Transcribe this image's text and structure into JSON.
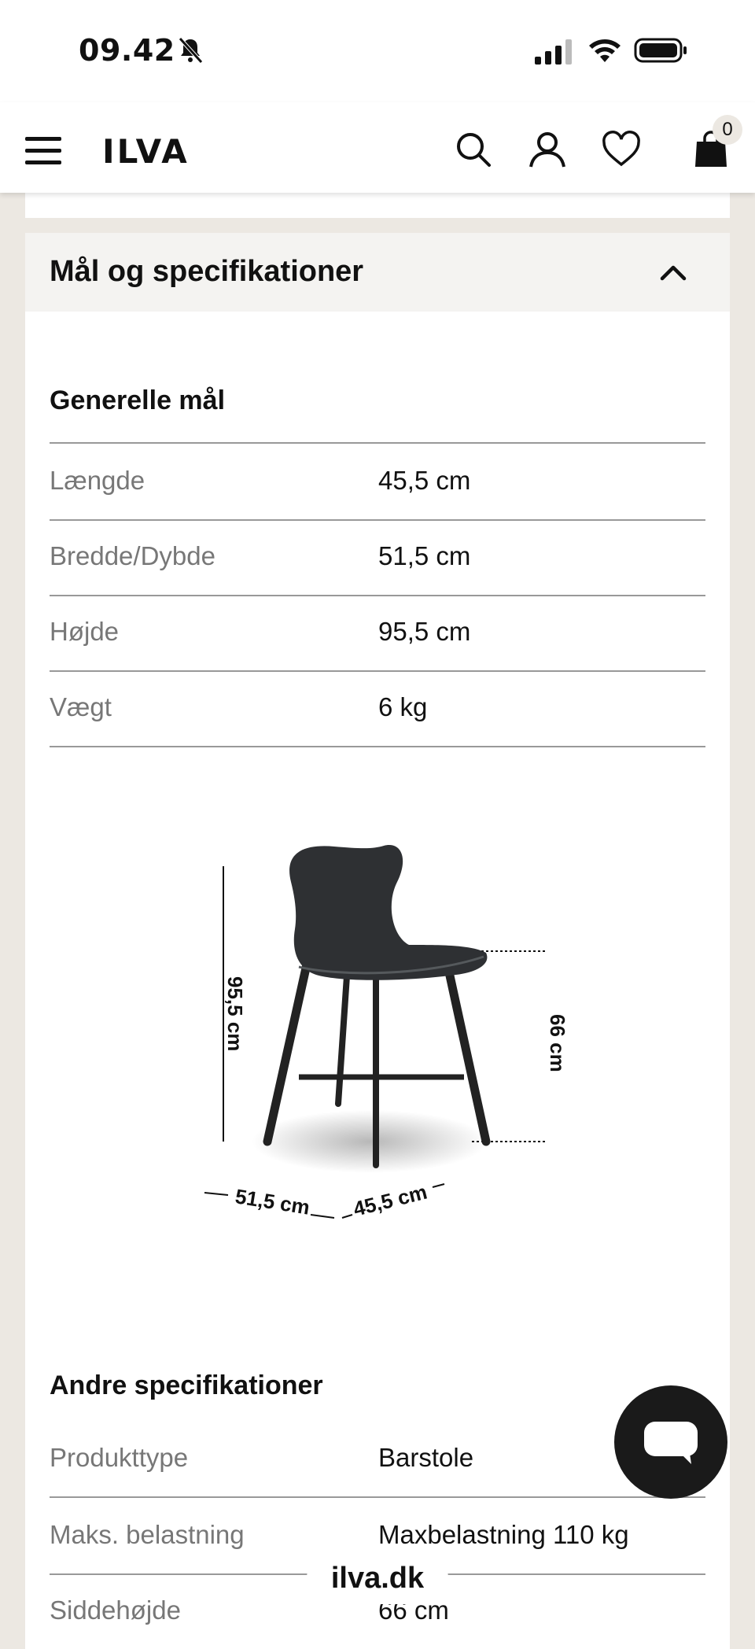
{
  "status_bar": {
    "time": "09.42"
  },
  "header": {
    "logo": "ILVA",
    "cart_count": "0"
  },
  "accordion": {
    "title": "Mål og specifikationer"
  },
  "general": {
    "title": "Generelle mål",
    "rows": [
      {
        "label": "Længde",
        "value": "45,5 cm"
      },
      {
        "label": "Bredde/Dybde",
        "value": "51,5 cm"
      },
      {
        "label": "Højde",
        "value": "95,5 cm"
      },
      {
        "label": "Vægt",
        "value": "6 kg"
      }
    ]
  },
  "diagram": {
    "height_label": "95,5 cm",
    "seat_label": "66 cm",
    "width_label": "51,5 cm",
    "depth_label": "45,5 cm"
  },
  "other": {
    "title": "Andre specifikationer",
    "rows": [
      {
        "label": "Produkttype",
        "value": "Barstole"
      },
      {
        "label": "Maks. belastning",
        "value": "Maxbelastning 110 kg"
      },
      {
        "label": "Siddehøjde",
        "value": "66 cm"
      }
    ]
  },
  "browser": {
    "url": "ilva.dk"
  },
  "colors": {
    "accent": "#1a1a1a",
    "page_bg": "#ece8e2",
    "panel_bg": "#f4f3f1"
  }
}
